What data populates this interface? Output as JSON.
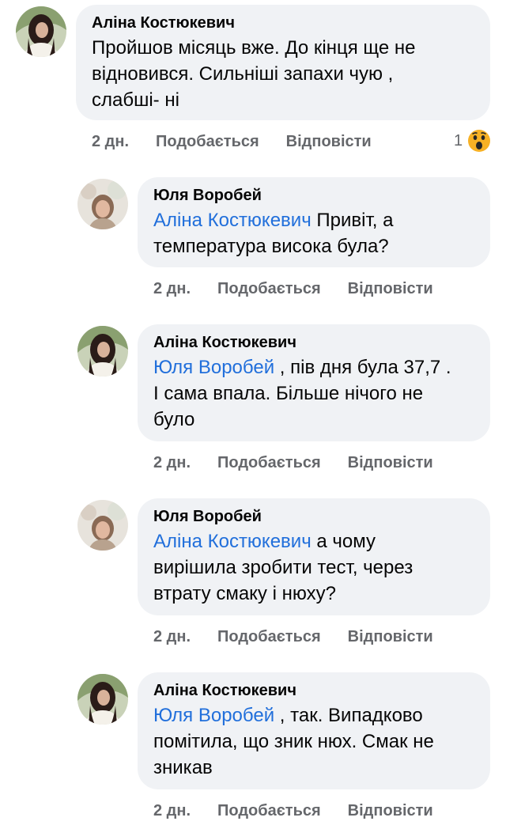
{
  "comments": [
    {
      "author": "Аліна Костюкевич",
      "mention": "",
      "text": "Пройшов місяць вже. До кінця ще не",
      "text2": "відновився. Сильніші запахи чую ,",
      "text3": "слабші- ні",
      "time": "2 дн.",
      "like": "Подобається",
      "reply": "Відповісти",
      "reaction_count": "1",
      "reaction_icon": "wow-reaction-icon"
    },
    {
      "author": "Юля Воробей",
      "mention": "Аліна Костюкевич",
      "text": " Привіт, а",
      "text2": "температура висока була?",
      "time": "2 дн.",
      "like": "Подобається",
      "reply": "Відповісти"
    },
    {
      "author": "Аліна Костюкевич",
      "mention": "Юля Воробей",
      "text": " , пів дня була 37,7 .",
      "text2": "І сама впала. Більше нічого не",
      "text3": "було",
      "time": "2 дн.",
      "like": "Подобається",
      "reply": "Відповісти"
    },
    {
      "author": "Юля Воробей",
      "mention": "Аліна Костюкевич",
      "text": " а чому",
      "text2": "вирішила зробити тест, через",
      "text3": "втрату смаку і нюху?",
      "time": "2 дн.",
      "like": "Подобається",
      "reply": "Відповісти"
    },
    {
      "author": "Аліна Костюкевич",
      "mention": "Юля Воробей",
      "text": " , так. Випадково",
      "text2": "помітила, що зник нюх. Смак не",
      "text3": "зникав",
      "time": "2 дн.",
      "like": "Подобається",
      "reply": "Відповісти"
    }
  ],
  "colors": {
    "bubble": "#f0f2f5",
    "mention": "#216fdb",
    "meta": "#65676b",
    "text": "#050505"
  }
}
